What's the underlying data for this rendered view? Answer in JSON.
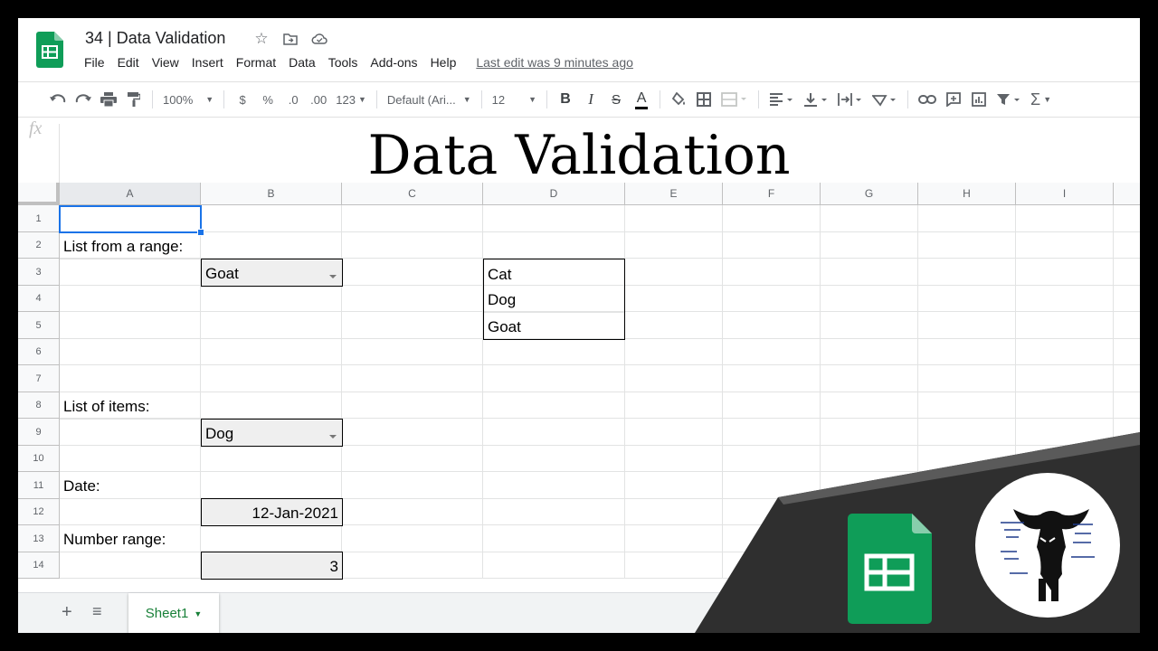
{
  "document": {
    "title": "34 | Data Validation",
    "last_edit": "Last edit was 9 minutes ago"
  },
  "menu": [
    "File",
    "Edit",
    "View",
    "Insert",
    "Format",
    "Data",
    "Tools",
    "Add-ons",
    "Help"
  ],
  "toolbar": {
    "zoom": "100%",
    "currency": "$",
    "percent": "%",
    "dec_decrease": ".0",
    "dec_increase": ".00",
    "more_formats": "123",
    "font": "Default (Ari...",
    "font_size": "12",
    "bold": "B",
    "italic": "I",
    "strike": "S",
    "text_color": "A"
  },
  "overlay_title": "Data Validation",
  "formula_label": "fx",
  "columns": [
    "A",
    "B",
    "C",
    "D",
    "E",
    "F",
    "G",
    "H",
    "I"
  ],
  "rows": [
    "1",
    "2",
    "3",
    "4",
    "5",
    "6",
    "7",
    "8",
    "9",
    "10",
    "11",
    "12",
    "13",
    "14"
  ],
  "cells": {
    "A2": "List from a range:",
    "B3": "Goat",
    "D3": "Cat",
    "D4": "Dog",
    "D5": "Goat",
    "A8": "List of items:",
    "B9": "Dog",
    "A11": "Date:",
    "B12": "12-Jan-2021",
    "A13": "Number range:",
    "B14": "3"
  },
  "sheet": {
    "tab_name": "Sheet1"
  },
  "colors": {
    "sheets_green": "#0f9d58",
    "selection_blue": "#1a73e8"
  }
}
